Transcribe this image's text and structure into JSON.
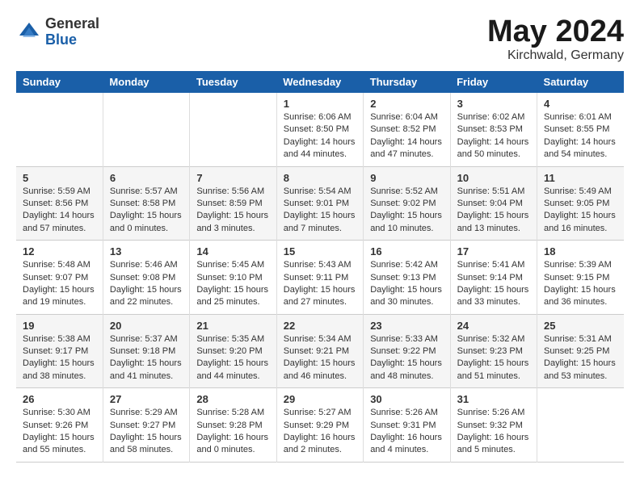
{
  "header": {
    "logo_general": "General",
    "logo_blue": "Blue",
    "month_title": "May 2024",
    "location": "Kirchwald, Germany"
  },
  "weekdays": [
    "Sunday",
    "Monday",
    "Tuesday",
    "Wednesday",
    "Thursday",
    "Friday",
    "Saturday"
  ],
  "weeks": [
    [
      {
        "day": "",
        "info": ""
      },
      {
        "day": "",
        "info": ""
      },
      {
        "day": "",
        "info": ""
      },
      {
        "day": "1",
        "info": "Sunrise: 6:06 AM\nSunset: 8:50 PM\nDaylight: 14 hours\nand 44 minutes."
      },
      {
        "day": "2",
        "info": "Sunrise: 6:04 AM\nSunset: 8:52 PM\nDaylight: 14 hours\nand 47 minutes."
      },
      {
        "day": "3",
        "info": "Sunrise: 6:02 AM\nSunset: 8:53 PM\nDaylight: 14 hours\nand 50 minutes."
      },
      {
        "day": "4",
        "info": "Sunrise: 6:01 AM\nSunset: 8:55 PM\nDaylight: 14 hours\nand 54 minutes."
      }
    ],
    [
      {
        "day": "5",
        "info": "Sunrise: 5:59 AM\nSunset: 8:56 PM\nDaylight: 14 hours\nand 57 minutes."
      },
      {
        "day": "6",
        "info": "Sunrise: 5:57 AM\nSunset: 8:58 PM\nDaylight: 15 hours\nand 0 minutes."
      },
      {
        "day": "7",
        "info": "Sunrise: 5:56 AM\nSunset: 8:59 PM\nDaylight: 15 hours\nand 3 minutes."
      },
      {
        "day": "8",
        "info": "Sunrise: 5:54 AM\nSunset: 9:01 PM\nDaylight: 15 hours\nand 7 minutes."
      },
      {
        "day": "9",
        "info": "Sunrise: 5:52 AM\nSunset: 9:02 PM\nDaylight: 15 hours\nand 10 minutes."
      },
      {
        "day": "10",
        "info": "Sunrise: 5:51 AM\nSunset: 9:04 PM\nDaylight: 15 hours\nand 13 minutes."
      },
      {
        "day": "11",
        "info": "Sunrise: 5:49 AM\nSunset: 9:05 PM\nDaylight: 15 hours\nand 16 minutes."
      }
    ],
    [
      {
        "day": "12",
        "info": "Sunrise: 5:48 AM\nSunset: 9:07 PM\nDaylight: 15 hours\nand 19 minutes."
      },
      {
        "day": "13",
        "info": "Sunrise: 5:46 AM\nSunset: 9:08 PM\nDaylight: 15 hours\nand 22 minutes."
      },
      {
        "day": "14",
        "info": "Sunrise: 5:45 AM\nSunset: 9:10 PM\nDaylight: 15 hours\nand 25 minutes."
      },
      {
        "day": "15",
        "info": "Sunrise: 5:43 AM\nSunset: 9:11 PM\nDaylight: 15 hours\nand 27 minutes."
      },
      {
        "day": "16",
        "info": "Sunrise: 5:42 AM\nSunset: 9:13 PM\nDaylight: 15 hours\nand 30 minutes."
      },
      {
        "day": "17",
        "info": "Sunrise: 5:41 AM\nSunset: 9:14 PM\nDaylight: 15 hours\nand 33 minutes."
      },
      {
        "day": "18",
        "info": "Sunrise: 5:39 AM\nSunset: 9:15 PM\nDaylight: 15 hours\nand 36 minutes."
      }
    ],
    [
      {
        "day": "19",
        "info": "Sunrise: 5:38 AM\nSunset: 9:17 PM\nDaylight: 15 hours\nand 38 minutes."
      },
      {
        "day": "20",
        "info": "Sunrise: 5:37 AM\nSunset: 9:18 PM\nDaylight: 15 hours\nand 41 minutes."
      },
      {
        "day": "21",
        "info": "Sunrise: 5:35 AM\nSunset: 9:20 PM\nDaylight: 15 hours\nand 44 minutes."
      },
      {
        "day": "22",
        "info": "Sunrise: 5:34 AM\nSunset: 9:21 PM\nDaylight: 15 hours\nand 46 minutes."
      },
      {
        "day": "23",
        "info": "Sunrise: 5:33 AM\nSunset: 9:22 PM\nDaylight: 15 hours\nand 48 minutes."
      },
      {
        "day": "24",
        "info": "Sunrise: 5:32 AM\nSunset: 9:23 PM\nDaylight: 15 hours\nand 51 minutes."
      },
      {
        "day": "25",
        "info": "Sunrise: 5:31 AM\nSunset: 9:25 PM\nDaylight: 15 hours\nand 53 minutes."
      }
    ],
    [
      {
        "day": "26",
        "info": "Sunrise: 5:30 AM\nSunset: 9:26 PM\nDaylight: 15 hours\nand 55 minutes."
      },
      {
        "day": "27",
        "info": "Sunrise: 5:29 AM\nSunset: 9:27 PM\nDaylight: 15 hours\nand 58 minutes."
      },
      {
        "day": "28",
        "info": "Sunrise: 5:28 AM\nSunset: 9:28 PM\nDaylight: 16 hours\nand 0 minutes."
      },
      {
        "day": "29",
        "info": "Sunrise: 5:27 AM\nSunset: 9:29 PM\nDaylight: 16 hours\nand 2 minutes."
      },
      {
        "day": "30",
        "info": "Sunrise: 5:26 AM\nSunset: 9:31 PM\nDaylight: 16 hours\nand 4 minutes."
      },
      {
        "day": "31",
        "info": "Sunrise: 5:26 AM\nSunset: 9:32 PM\nDaylight: 16 hours\nand 5 minutes."
      },
      {
        "day": "",
        "info": ""
      }
    ]
  ]
}
